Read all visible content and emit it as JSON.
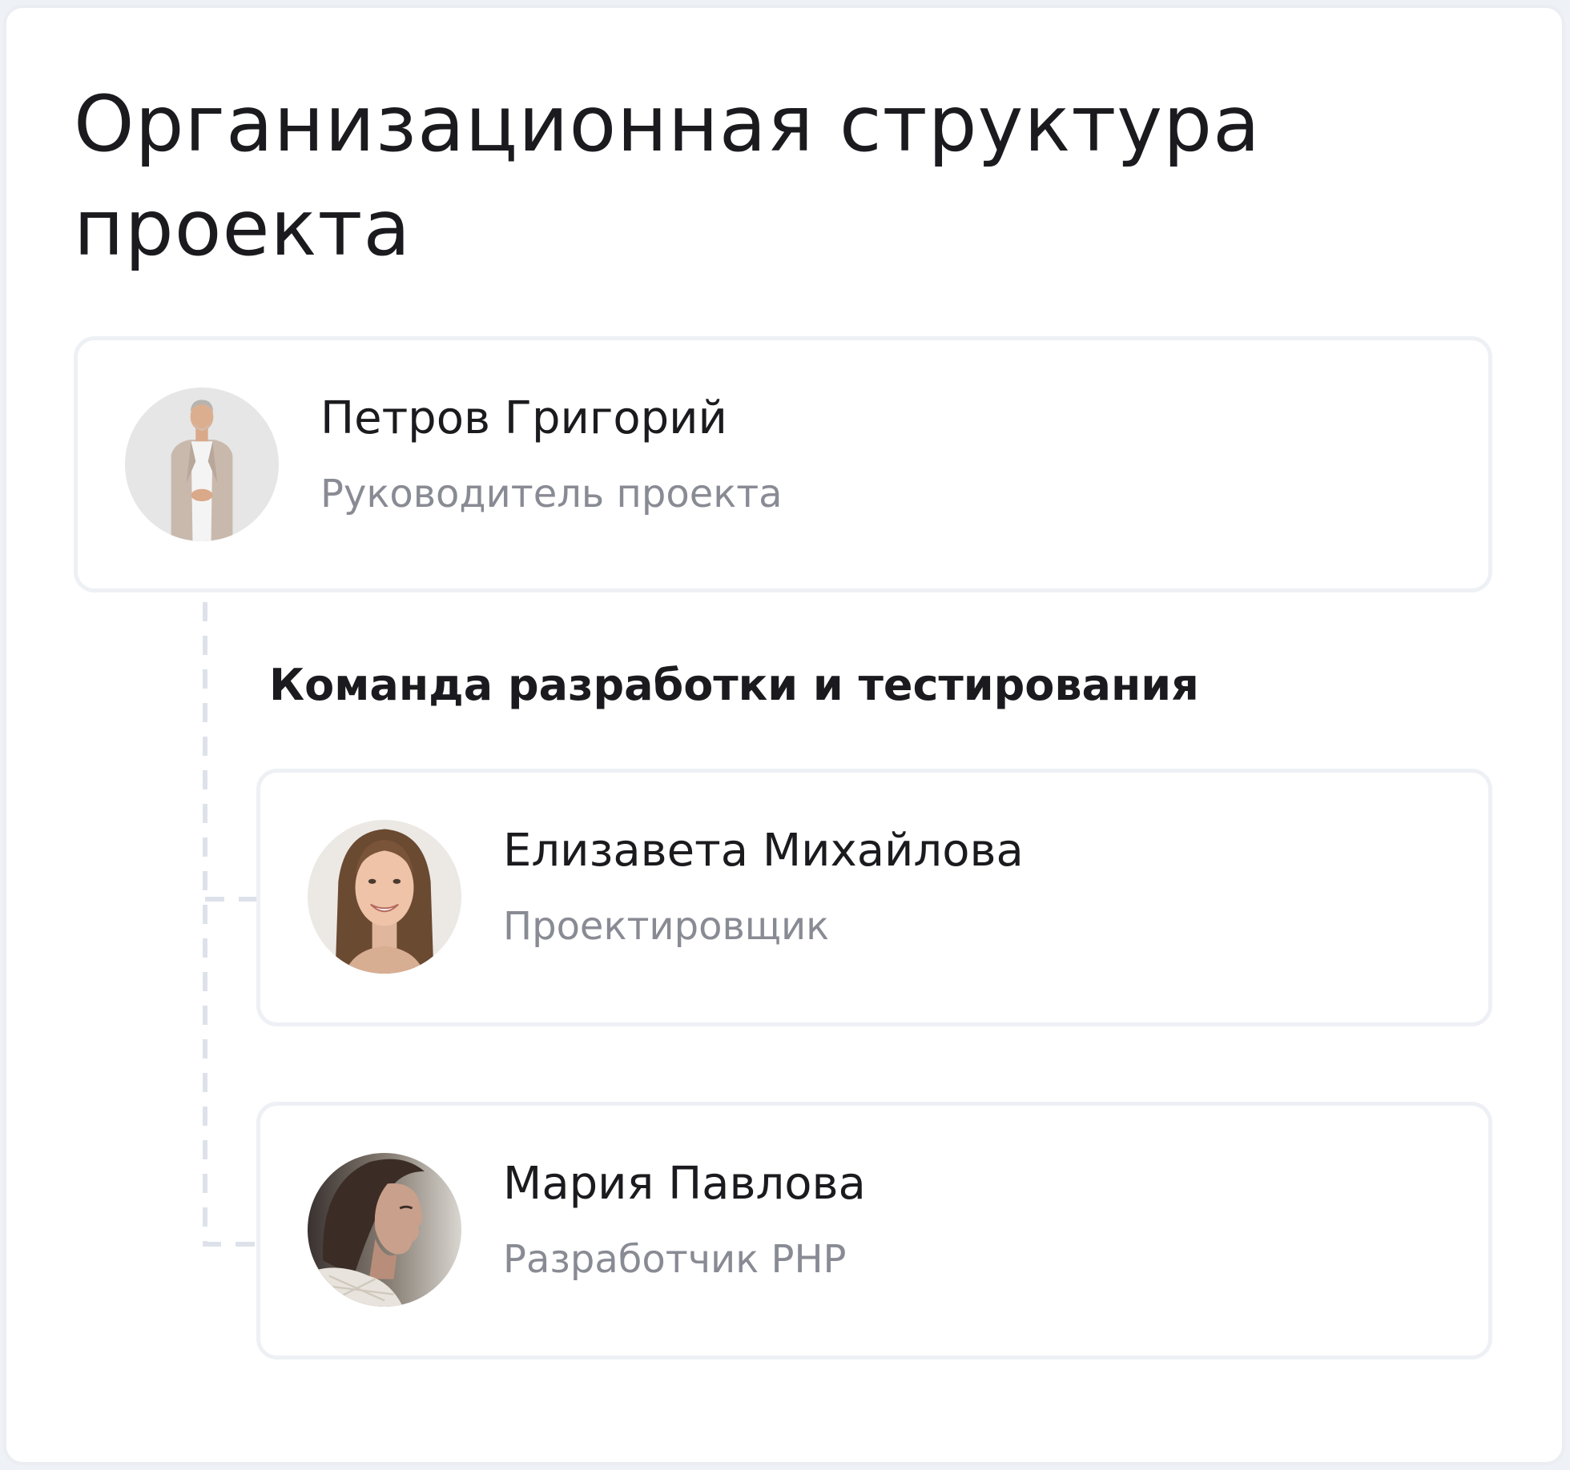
{
  "page": {
    "title": "Организационная структура проекта"
  },
  "lead": {
    "name": "Петров Григорий",
    "role": "Руководитель проекта",
    "avatar_icon": "avatar-photo-man"
  },
  "team": {
    "heading": "Команда разработки и тестирования",
    "members": [
      {
        "name": "Елизавета Михайлова",
        "role": "Проектировщик",
        "avatar_icon": "avatar-photo-woman"
      },
      {
        "name": "Мария Павлова",
        "role": "Разработчик PHP",
        "avatar_icon": "avatar-photo-woman"
      }
    ]
  },
  "colors": {
    "text": "#1b1b1f",
    "muted": "#898b94",
    "border": "#edf0f4",
    "connector": "#dde2ea"
  }
}
